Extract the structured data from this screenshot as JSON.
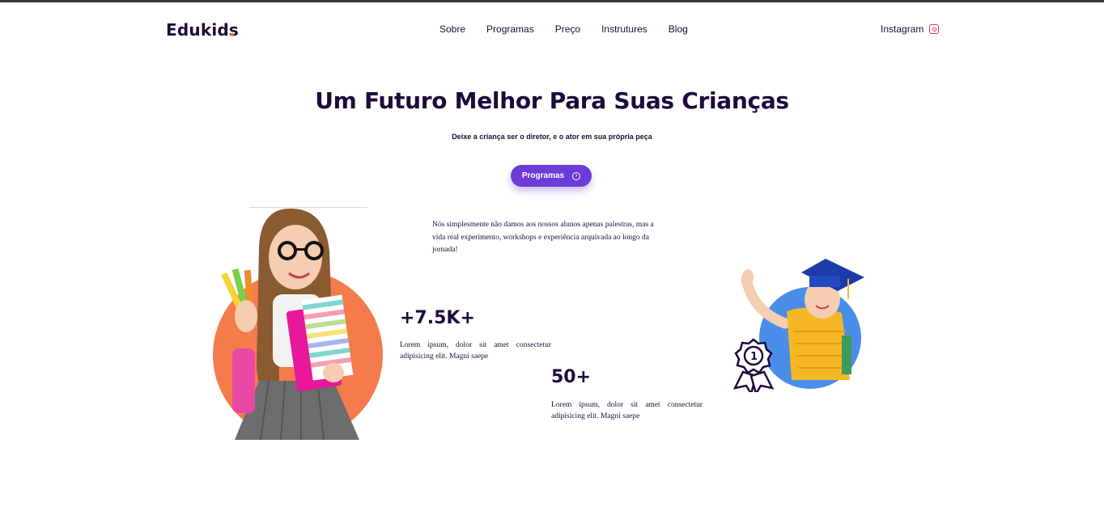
{
  "header": {
    "logo": "Edukids",
    "nav": [
      "Sobre",
      "Programas",
      "Preço",
      "Instrutures",
      "Blog"
    ],
    "social_label": "Instagram",
    "social_icon": "instagram-icon"
  },
  "hero": {
    "title": "Um Futuro Melhor Para Suas Crianças",
    "subtitle": "Deixe a criança ser o diretor, e o ator em sua própria peça",
    "cta_label": "Programas",
    "cta_icon": "arrow-circle-icon"
  },
  "about": {
    "intro": "Nós simplesmente não damos aos nossos alunos apenas palestras, mas a vida real experimento, workshops e experiência arquivada ao longo da jornada!",
    "stats": [
      {
        "value": "+7.5K+",
        "description": "Lorem ipsum, dolor sit amet consectetur adipisicing elit. Magni saepe"
      },
      {
        "value": "50+",
        "description": "Lorem ipsum, dolor sit amet consectetur adipisicing elit. Magni saepe"
      }
    ]
  },
  "colors": {
    "brand_dark": "#1c0b3b",
    "accent_purple": "#6c3bd8",
    "girl_circle": "#f47c4c",
    "boy_circle": "#4a8de8",
    "logo_dot": "#f26b3a"
  }
}
